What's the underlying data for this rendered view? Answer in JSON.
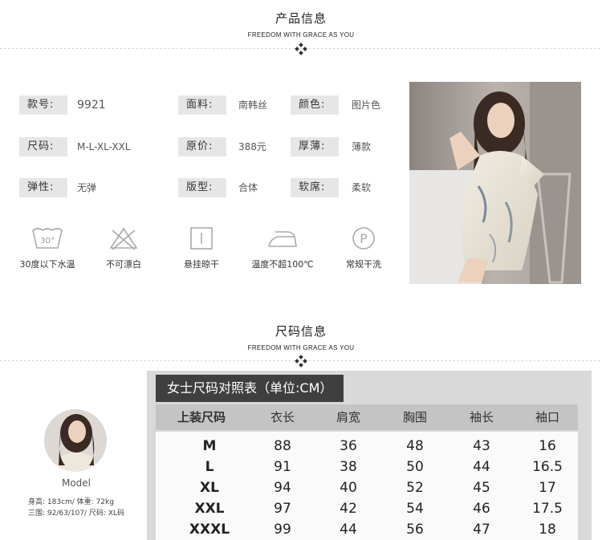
{
  "product_section": {
    "title": "产品信息",
    "subtitle": "FREEDOM WITH GRACE AS YOU"
  },
  "specs": [
    {
      "label": "款号:",
      "value": "9921"
    },
    {
      "label": "面料:",
      "value": "南韩丝"
    },
    {
      "label": "颜色:",
      "value": "图片色"
    },
    {
      "label": "尺码:",
      "value": "M-L-XL-XXL"
    },
    {
      "label": "原价:",
      "value": "388元"
    },
    {
      "label": "厚薄:",
      "value": "薄款"
    },
    {
      "label": "弹性:",
      "value": "无弹"
    },
    {
      "label": "版型:",
      "value": "合体"
    },
    {
      "label": "软席:",
      "value": "柔软"
    }
  ],
  "care": [
    {
      "icon": "wash-30-icon",
      "icon_text": "30°",
      "label": "30度以下水温"
    },
    {
      "icon": "no-bleach-icon",
      "label": "不可漂白"
    },
    {
      "icon": "hang-dry-icon",
      "label": "悬挂晾干"
    },
    {
      "icon": "iron-icon",
      "label": "温度不超100℃"
    },
    {
      "icon": "dry-clean-p-icon",
      "icon_text": "P",
      "label": "常规干洗"
    }
  ],
  "size_section": {
    "title": "尺码信息",
    "subtitle": "FREEDOM WITH GRACE AS YOU"
  },
  "model": {
    "name": "Model",
    "line1": "身高: 183cm/ 体重: 72kg",
    "line2": "三围: 92/63/107/ 尺码: XL码"
  },
  "size_table": {
    "title": "女士尺码对照表（单位:CM）",
    "headers": [
      "上装尺码",
      "衣长",
      "肩宽",
      "胸围",
      "袖长",
      "袖口"
    ],
    "rows": [
      [
        "M",
        "88",
        "36",
        "48",
        "43",
        "16"
      ],
      [
        "L",
        "91",
        "38",
        "50",
        "44",
        "16.5"
      ],
      [
        "XL",
        "94",
        "40",
        "52",
        "45",
        "17"
      ],
      [
        "XXL",
        "97",
        "42",
        "54",
        "46",
        "17.5"
      ],
      [
        "XXXL",
        "99",
        "44",
        "56",
        "47",
        "18"
      ]
    ]
  },
  "colors": {
    "label_bg": "#e6e6e6",
    "table_panel": "#d9d9d9",
    "table_header": "#c4c4c4",
    "table_title_bg": "#3f3f3f"
  }
}
